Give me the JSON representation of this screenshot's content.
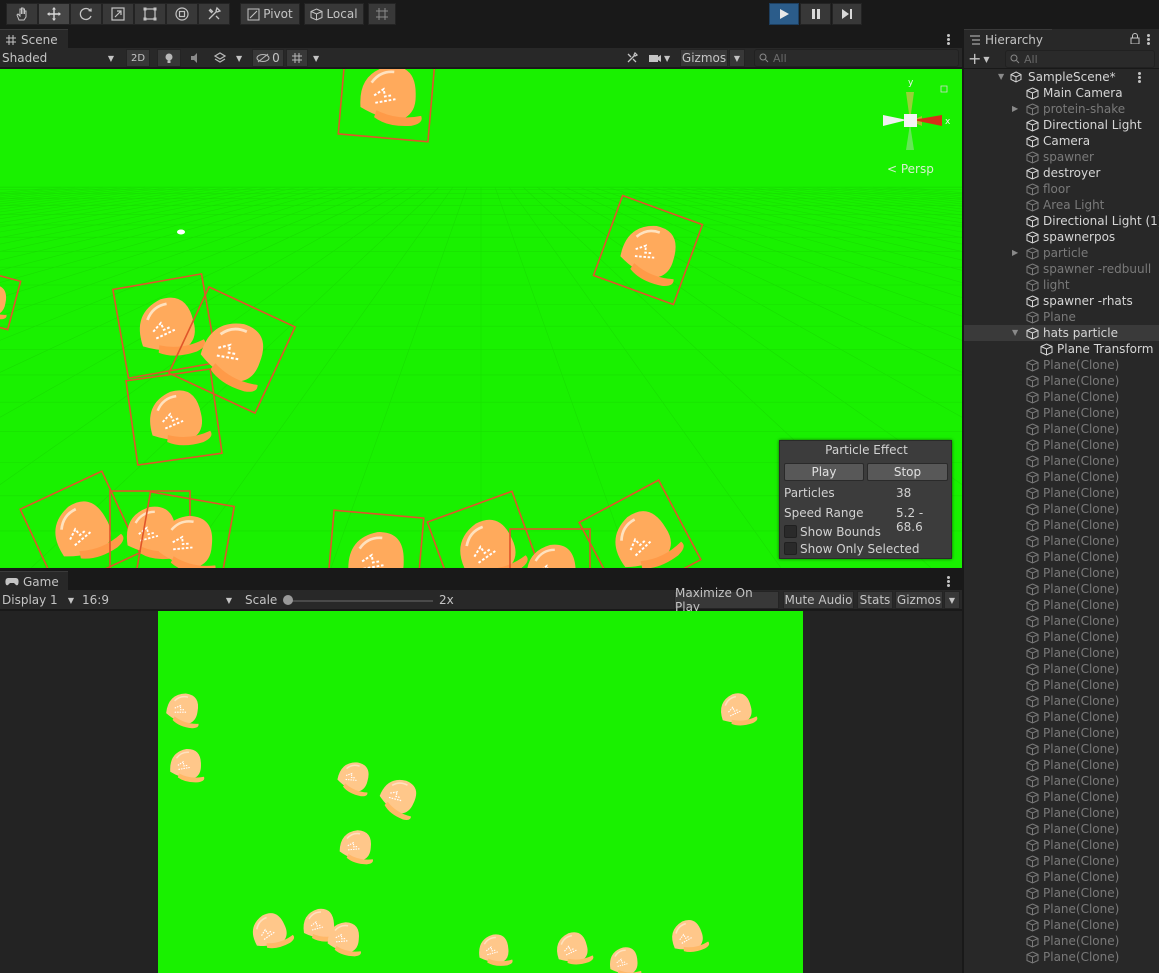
{
  "toolbar": {
    "tools": [
      "hand-tool-icon",
      "move-tool-icon",
      "rotate-tool-icon",
      "scale-tool-icon",
      "rect-tool-icon",
      "transform-tool-icon",
      "custom-tool-icon"
    ],
    "pivot_label": "Pivot",
    "local_label": "Local",
    "play_state": "playing"
  },
  "scene": {
    "tab_label": "Scene",
    "shading_mode": "Shaded",
    "mode_2d_label": "2D",
    "hidden_count": "0",
    "gizmos_label": "Gizmos",
    "search_placeholder": "All",
    "persp_label": "< Persp",
    "axis_y": "y",
    "axis_x": "x"
  },
  "particle_effect": {
    "title": "Particle Effect",
    "play_label": "Play",
    "stop_label": "Stop",
    "particles_label": "Particles",
    "particles_value": "38",
    "speed_label": "Speed Range",
    "speed_value": "5.2 - 68.6",
    "show_bounds_label": "Show Bounds",
    "show_bounds_checked": false,
    "show_only_selected_label": "Show Only Selected",
    "show_only_selected_checked": false
  },
  "game": {
    "tab_label": "Game",
    "display_label": "Display 1",
    "aspect_label": "16:9",
    "scale_label": "Scale",
    "scale_value": "2x",
    "maximize_label": "Maximize On Play",
    "mute_label": "Mute Audio",
    "stats_label": "Stats",
    "gizmos_label": "Gizmos"
  },
  "hierarchy": {
    "tab_label": "Hierarchy",
    "search_placeholder": "All",
    "scene_name": "SampleScene*",
    "items": [
      {
        "label": "Main Camera",
        "active": true,
        "depth": 1,
        "expand": false
      },
      {
        "label": "protein-shake",
        "active": false,
        "depth": 1,
        "expand": true
      },
      {
        "label": "Directional Light",
        "active": true,
        "depth": 1,
        "expand": false
      },
      {
        "label": "Camera",
        "active": true,
        "depth": 1,
        "expand": false
      },
      {
        "label": "spawner",
        "active": false,
        "depth": 1,
        "expand": false
      },
      {
        "label": "destroyer",
        "active": true,
        "depth": 1,
        "expand": false
      },
      {
        "label": "floor",
        "active": false,
        "depth": 1,
        "expand": false
      },
      {
        "label": "Area Light",
        "active": false,
        "depth": 1,
        "expand": false
      },
      {
        "label": "Directional Light (1)",
        "active": true,
        "depth": 1,
        "expand": false
      },
      {
        "label": "spawnerpos",
        "active": true,
        "depth": 1,
        "expand": false
      },
      {
        "label": "particle",
        "active": false,
        "depth": 1,
        "expand": true
      },
      {
        "label": "spawner -redbuull",
        "active": false,
        "depth": 1,
        "expand": false
      },
      {
        "label": "light",
        "active": false,
        "depth": 1,
        "expand": false
      },
      {
        "label": "spawner -rhats",
        "active": true,
        "depth": 1,
        "expand": false
      },
      {
        "label": "Plane",
        "active": false,
        "depth": 1,
        "expand": false
      },
      {
        "label": "hats particle",
        "active": true,
        "depth": 1,
        "expand": "open",
        "selected": true
      },
      {
        "label": "Plane Transform",
        "active": true,
        "depth": 2,
        "expand": false
      }
    ],
    "clone_label": "Plane(Clone)",
    "clone_count": 38
  }
}
